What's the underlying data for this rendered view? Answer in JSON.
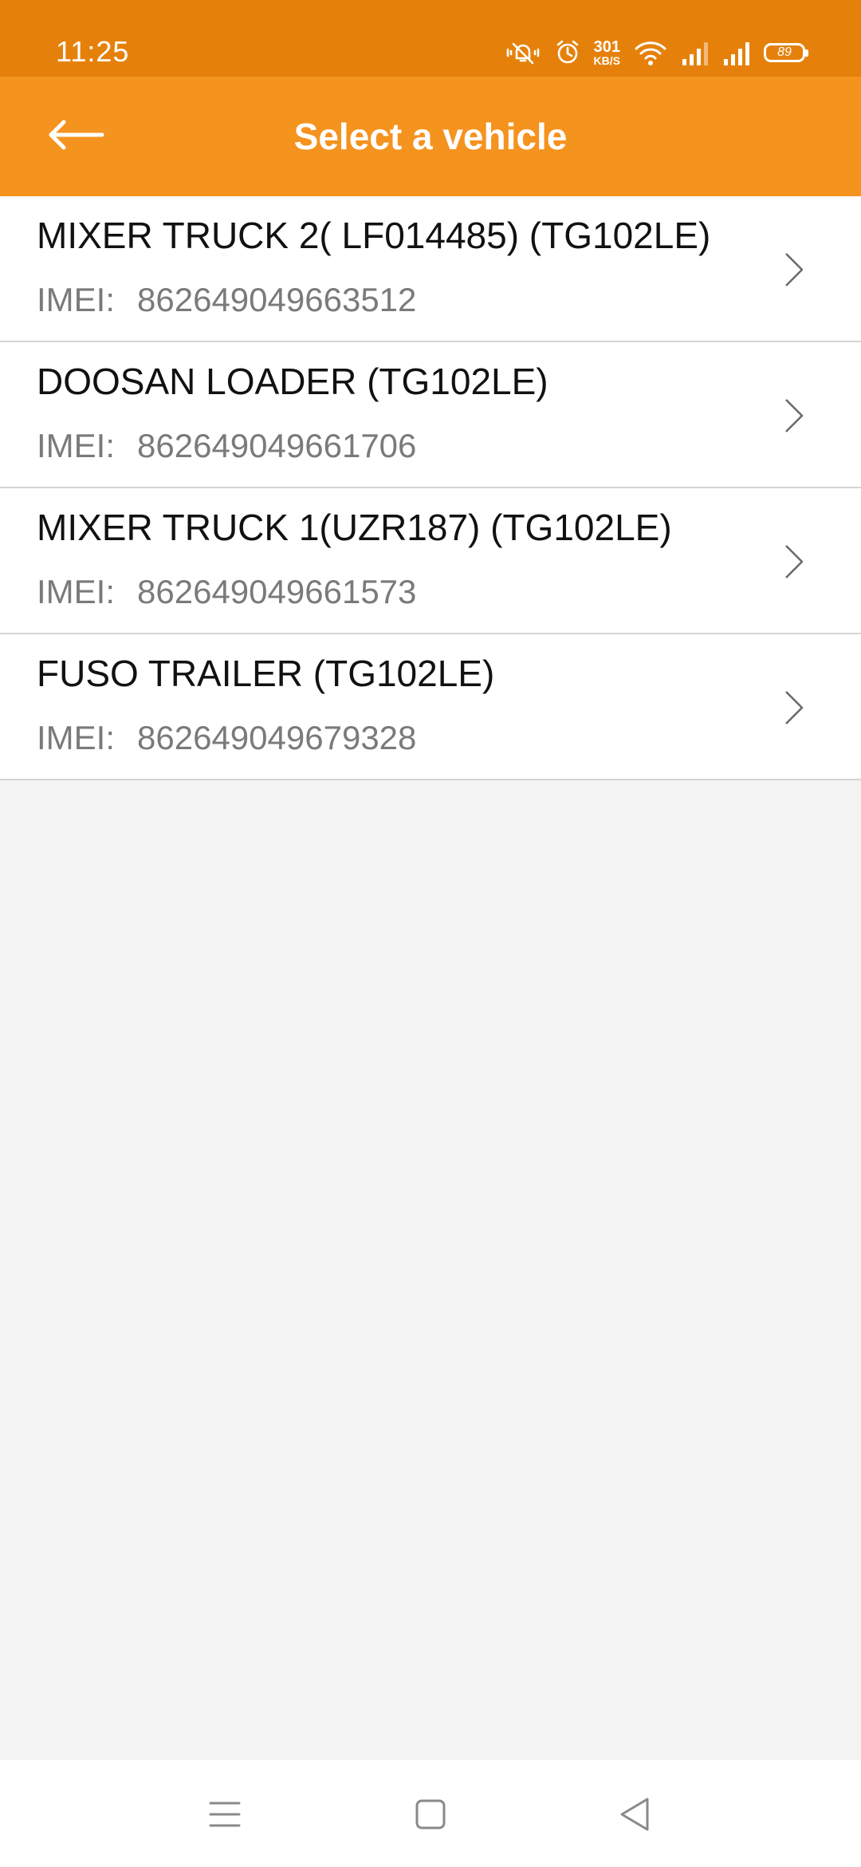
{
  "status_bar": {
    "time": "11:25",
    "net_speed_value": "301",
    "net_speed_unit": "KB/S",
    "battery_level": "89",
    "icons": [
      "vibrate-mute-icon",
      "alarm-icon",
      "wifi-icon",
      "signal-icon",
      "signal-icon",
      "battery-icon"
    ]
  },
  "app_bar": {
    "title": "Select a vehicle",
    "back_icon": "arrow-left-icon"
  },
  "vehicles": [
    {
      "name": "MIXER TRUCK 2( LF014485) (TG102LE)",
      "imei_label": "IMEI:",
      "imei": "862649049663512"
    },
    {
      "name": "DOOSAN LOADER (TG102LE)",
      "imei_label": "IMEI:",
      "imei": "862649049661706"
    },
    {
      "name": "MIXER TRUCK 1(UZR187) (TG102LE)",
      "imei_label": "IMEI:",
      "imei": "862649049661573"
    },
    {
      "name": "FUSO TRAILER (TG102LE)",
      "imei_label": "IMEI:",
      "imei": "862649049679328"
    }
  ],
  "nav_bar": {
    "buttons": [
      "menu-icon",
      "home-icon",
      "back-icon"
    ]
  },
  "colors": {
    "status_bar": "#e5810b",
    "app_bar": "#f5931f",
    "background": "#f3f3f3"
  }
}
